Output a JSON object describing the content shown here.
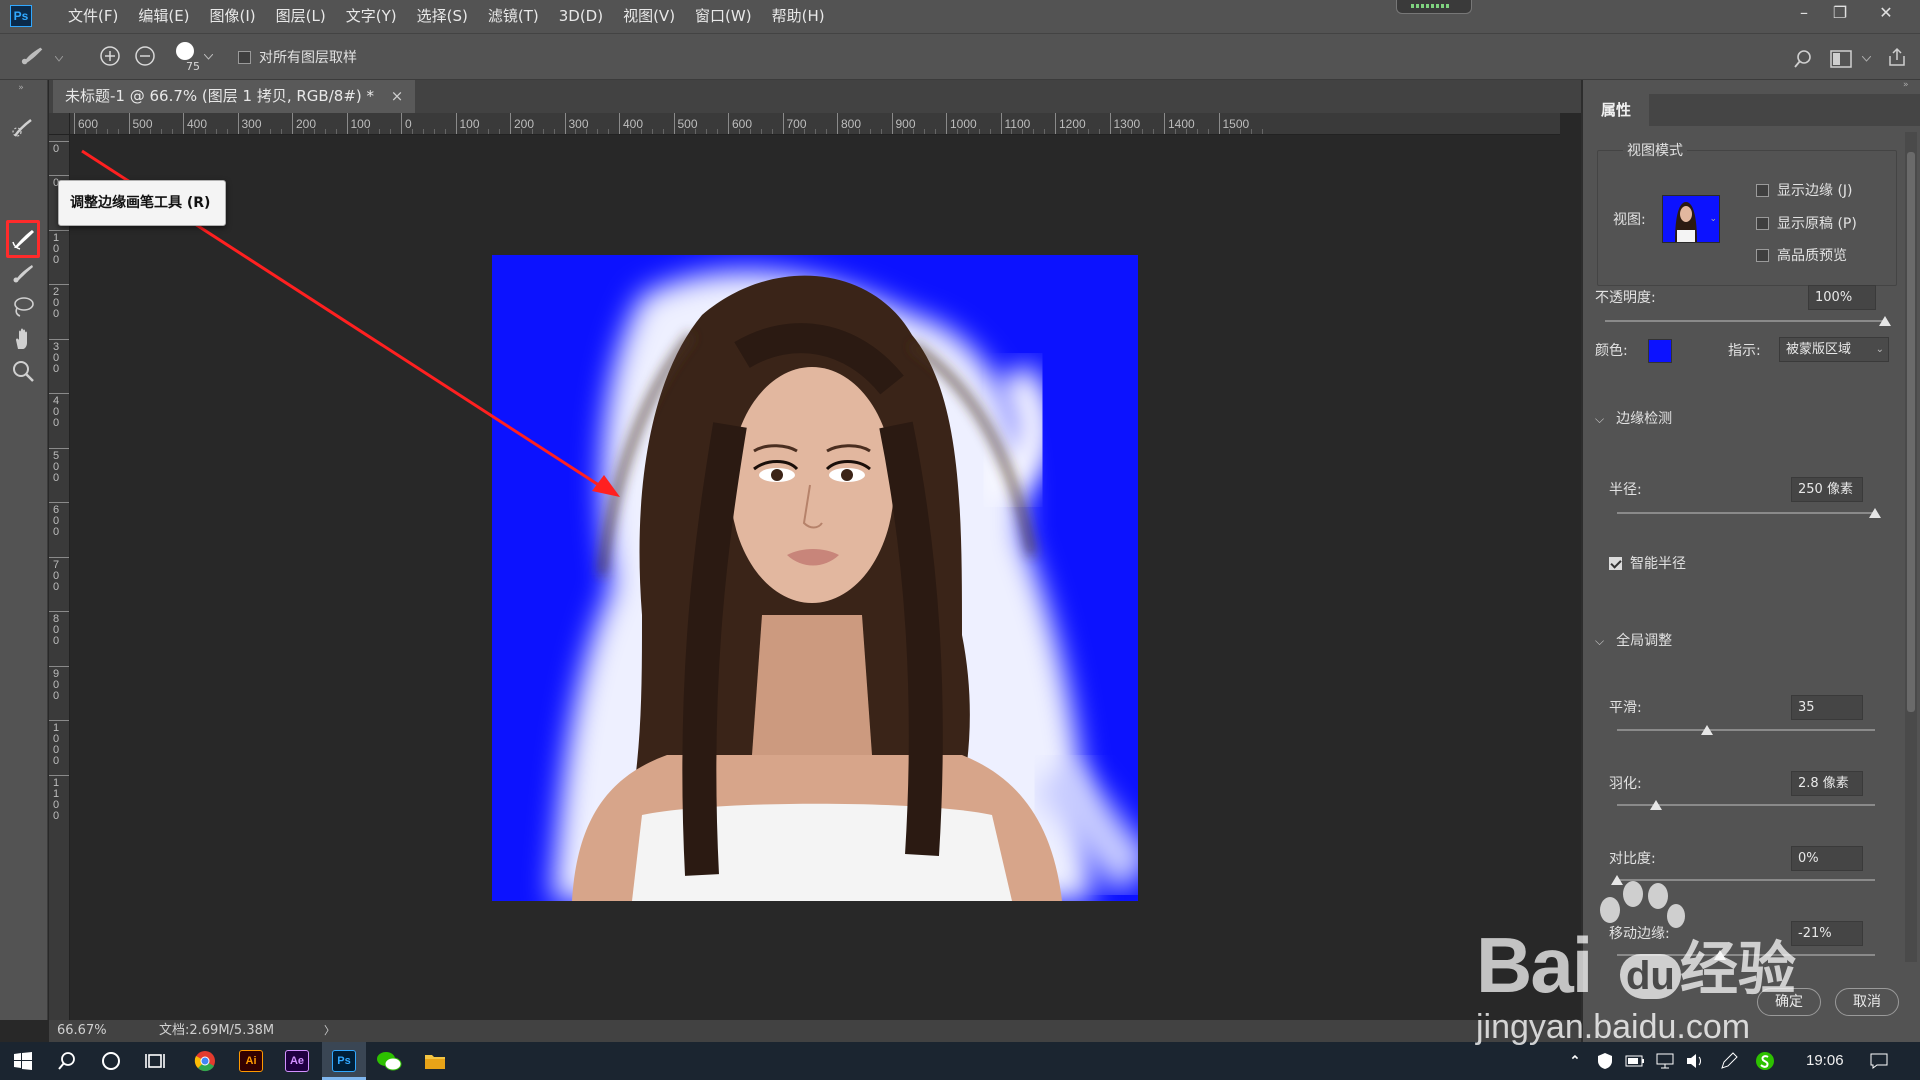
{
  "app": {
    "logo": "Ps",
    "menu": [
      "文件(F)",
      "编辑(E)",
      "图像(I)",
      "图层(L)",
      "文字(Y)",
      "选择(S)",
      "滤镜(T)",
      "3D(D)",
      "视图(V)",
      "窗口(W)",
      "帮助(H)"
    ],
    "window_controls": [
      "–",
      "❐",
      "✕"
    ]
  },
  "options": {
    "brush_size": "75",
    "sample_all_layers_label": "对所有图层取样",
    "sample_all_layers_checked": false
  },
  "document": {
    "tab_title": "未标题-1 @ 66.7% (图层 1 拷贝, RGB/8#) *",
    "close": "×",
    "ruler_top_labels": [
      "600",
      "500",
      "400",
      "300",
      "200",
      "100",
      "0",
      "100",
      "200",
      "300",
      "400",
      "500",
      "600",
      "700",
      "800",
      "900",
      "1000",
      "1100",
      "1200",
      "1300",
      "1400",
      "1500"
    ],
    "ruler_left_labels": [
      "0",
      "0",
      "100",
      "200",
      "300",
      "400",
      "500",
      "600",
      "700",
      "800",
      "900",
      "1000",
      "1100"
    ]
  },
  "tooltip": "调整边缘画笔工具 (R)",
  "status": {
    "zoom": "66.67%",
    "doc_size": "文档:2.69M/5.38M",
    "arrow": "〉"
  },
  "properties": {
    "tab": "属性",
    "view_mode_title": "视图模式",
    "view_label": "视图:",
    "show_edge": "显示边缘 (J)",
    "show_original": "显示原稿 (P)",
    "high_quality": "高品质预览",
    "opacity_label": "不透明度:",
    "opacity_value": "100%",
    "opacity_fraction": 1.0,
    "color_label": "颜色:",
    "color_value": "#0c12ff",
    "indicate_label": "指示:",
    "indicate_value": "被蒙版区域",
    "edge_detection": "边缘检测",
    "radius_label": "半径:",
    "radius_value": "250 像素",
    "radius_fraction": 1.0,
    "smart_radius": "智能半径",
    "smart_radius_checked": true,
    "global_refine": "全局调整",
    "smooth_label": "平滑:",
    "smooth_value": "35",
    "smooth_fraction": 0.35,
    "feather_label": "羽化:",
    "feather_value": "2.8 像素",
    "feather_fraction": 0.15,
    "contrast_label": "对比度:",
    "contrast_value": "0%",
    "contrast_fraction": 0.0,
    "shift_edge_label": "移动边缘:",
    "shift_edge_value": "-21%",
    "shift_edge_fraction": 0.4,
    "ok": "确定",
    "cancel": "取消"
  },
  "taskbar": {
    "apps": [
      "Ai",
      "Ae",
      "Ps"
    ],
    "clock": "19:06"
  },
  "watermark": {
    "brand": "Bai",
    "paw": "du",
    "site": "经验",
    "url": "jingyan.baidu.com"
  }
}
